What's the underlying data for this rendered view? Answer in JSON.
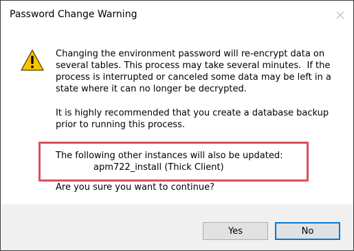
{
  "dialog": {
    "title": "Password Change Warning",
    "close_icon": "close-icon"
  },
  "message": {
    "icon": "warning-icon",
    "paragraph1_lines": [
      "Changing the environment password will re-encrypt data on",
      "several tables. This process may take several minutes.  If the",
      "process is interrupted or canceled some data may be left in a",
      "state where it can no longer be decrypted."
    ],
    "paragraph2_lines": [
      "It is highly recommended that you create a database backup",
      "prior to running this process."
    ],
    "instances_heading": "The following other instances will also be updated:",
    "instance_name": "apm722_install (Thick Client)",
    "question": "Are you sure you want to continue?"
  },
  "buttons": {
    "yes_label": "Yes",
    "no_label": "No"
  },
  "colors": {
    "highlight_border": "#d94f5c",
    "warning_fill": "#f7c500",
    "default_button_border": "#0078d7",
    "footer_bg": "#f0f0f0"
  }
}
